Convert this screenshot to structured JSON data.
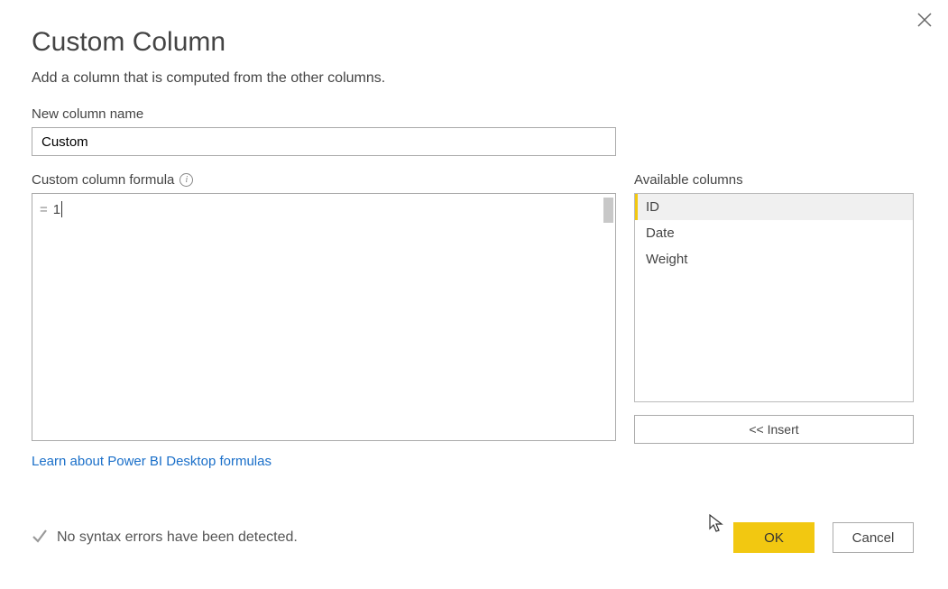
{
  "dialog": {
    "title": "Custom Column",
    "subtitle": "Add a column that is computed from the other columns.",
    "name_label": "New column name",
    "name_value": "Custom",
    "formula_label": "Custom column formula",
    "formula_equals": "=",
    "formula_value": "1",
    "available_label": "Available columns",
    "available_items": [
      "ID",
      "Date",
      "Weight"
    ],
    "selected_index": 0,
    "insert_label": "<< Insert",
    "learn_link": "Learn about Power BI Desktop formulas",
    "status_text": "No syntax errors have been detected.",
    "ok_label": "OK",
    "cancel_label": "Cancel"
  },
  "colors": {
    "accent": "#f2c811",
    "link": "#1a6fc9"
  }
}
